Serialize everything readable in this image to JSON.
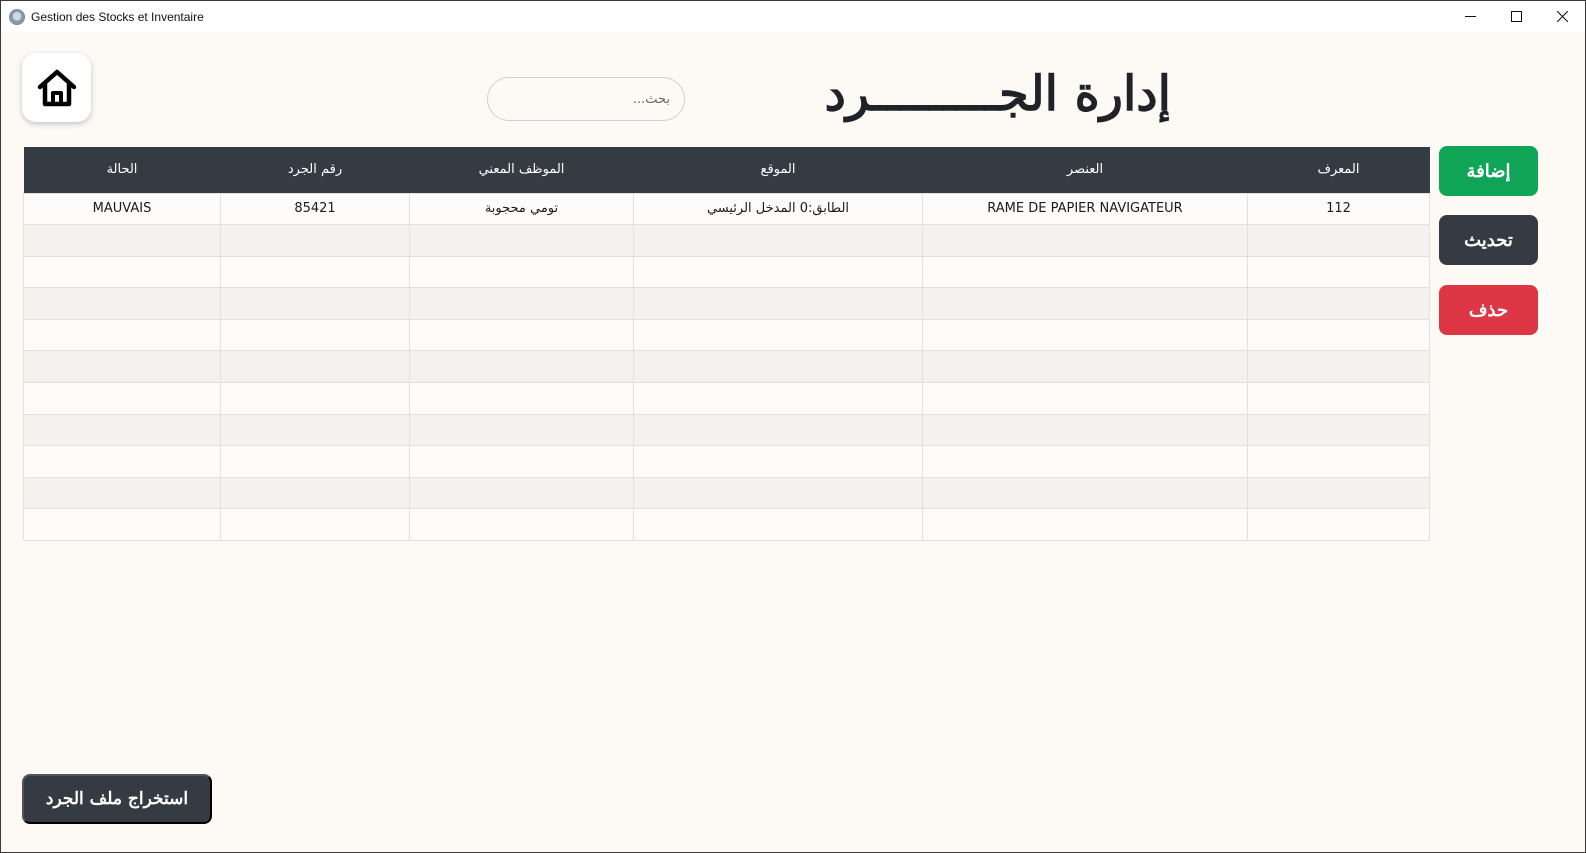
{
  "window": {
    "title": "Gestion des Stocks et Inventaire",
    "minimize_symbol": "—",
    "maximize_symbol": "☐",
    "close_symbol": "✕"
  },
  "header": {
    "title": "إدارة الجـــــــــرد",
    "search_placeholder": "بحث..."
  },
  "table": {
    "columns": [
      "المعرف",
      "العنصر",
      "الموقع",
      "الموظف المعني",
      "رقم الجرد",
      "الحالة"
    ],
    "rows": [
      {
        "id": "112",
        "item": "RAME DE PAPIER NAVIGATEUR",
        "location": "الطابق:0   المدخل الرئيسي",
        "employee": "تومي محجوبة",
        "inventory_no": "85421",
        "status": "MAUVAIS"
      },
      {
        "id": "",
        "item": "",
        "location": "",
        "employee": "",
        "inventory_no": "",
        "status": ""
      },
      {
        "id": "",
        "item": "",
        "location": "",
        "employee": "",
        "inventory_no": "",
        "status": ""
      },
      {
        "id": "",
        "item": "",
        "location": "",
        "employee": "",
        "inventory_no": "",
        "status": ""
      },
      {
        "id": "",
        "item": "",
        "location": "",
        "employee": "",
        "inventory_no": "",
        "status": ""
      },
      {
        "id": "",
        "item": "",
        "location": "",
        "employee": "",
        "inventory_no": "",
        "status": ""
      },
      {
        "id": "",
        "item": "",
        "location": "",
        "employee": "",
        "inventory_no": "",
        "status": ""
      },
      {
        "id": "",
        "item": "",
        "location": "",
        "employee": "",
        "inventory_no": "",
        "status": ""
      },
      {
        "id": "",
        "item": "",
        "location": "",
        "employee": "",
        "inventory_no": "",
        "status": ""
      },
      {
        "id": "",
        "item": "",
        "location": "",
        "employee": "",
        "inventory_no": "",
        "status": ""
      },
      {
        "id": "",
        "item": "",
        "location": "",
        "employee": "",
        "inventory_no": "",
        "status": ""
      }
    ]
  },
  "actions": {
    "add_label": "إضافة",
    "update_label": "تحديث",
    "delete_label": "حذف",
    "export_label": "استخراج ملف الجرد"
  },
  "icons": {
    "home": "home-icon",
    "app": "app-icon"
  },
  "colors": {
    "header_dark": "#353b43",
    "add_green": "#10a457",
    "delete_red": "#dd3644",
    "background": "#fdfaf5"
  }
}
